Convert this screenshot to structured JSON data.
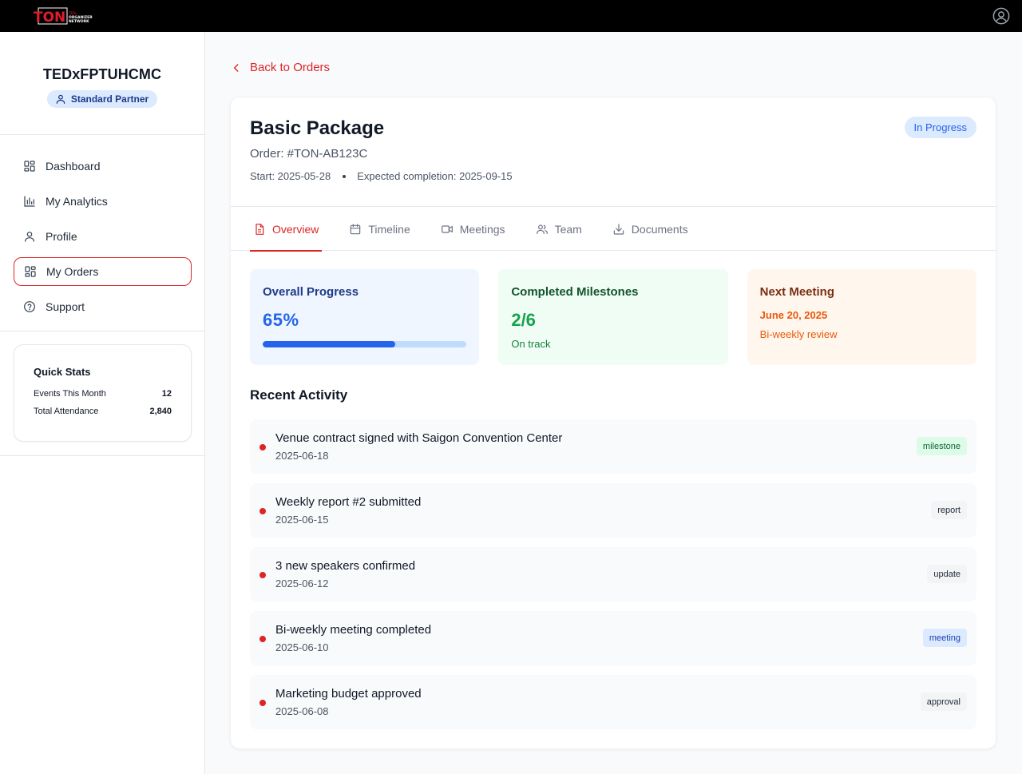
{
  "header": {
    "logo_text": "TON"
  },
  "sidebar": {
    "org_name": "TEDxFPTUHCMC",
    "partner_badge": "Standard Partner",
    "nav": [
      {
        "label": "Dashboard",
        "icon": "dashboard-icon",
        "active": false
      },
      {
        "label": "My Analytics",
        "icon": "analytics-icon",
        "active": false
      },
      {
        "label": "Profile",
        "icon": "user-icon",
        "active": false
      },
      {
        "label": "My Orders",
        "icon": "orders-icon",
        "active": true
      },
      {
        "label": "Support",
        "icon": "help-icon",
        "active": false
      }
    ],
    "quick_stats": {
      "title": "Quick Stats",
      "rows": [
        {
          "label": "Events This Month",
          "value": "12"
        },
        {
          "label": "Total Attendance",
          "value": "2,840"
        }
      ]
    }
  },
  "main": {
    "back_label": "Back to Orders",
    "package": {
      "title": "Basic Package",
      "order_id": "Order: #TON-AB123C",
      "start": "Start: 2025-05-28",
      "expected": "Expected completion: 2025-09-15",
      "status": "In Progress"
    },
    "tabs": [
      {
        "label": "Overview",
        "icon": "document-icon",
        "active": true
      },
      {
        "label": "Timeline",
        "icon": "calendar-icon",
        "active": false
      },
      {
        "label": "Meetings",
        "icon": "video-icon",
        "active": false
      },
      {
        "label": "Team",
        "icon": "team-icon",
        "active": false
      },
      {
        "label": "Documents",
        "icon": "download-icon",
        "active": false
      }
    ],
    "metrics": {
      "progress": {
        "title": "Overall Progress",
        "value": "65%",
        "fraction": 0.65
      },
      "milestones": {
        "title": "Completed Milestones",
        "value": "2/6",
        "sub": "On track"
      },
      "meeting": {
        "title": "Next Meeting",
        "date": "June 20, 2025",
        "sub": "Bi-weekly review"
      }
    },
    "recent_title": "Recent Activity",
    "activities": [
      {
        "title": "Venue contract signed with Saigon Convention Center",
        "date": "2025-06-18",
        "tag": "milestone"
      },
      {
        "title": "Weekly report #2 submitted",
        "date": "2025-06-15",
        "tag": "report"
      },
      {
        "title": "3 new speakers confirmed",
        "date": "2025-06-12",
        "tag": "update"
      },
      {
        "title": "Bi-weekly meeting completed",
        "date": "2025-06-10",
        "tag": "meeting"
      },
      {
        "title": "Marketing budget approved",
        "date": "2025-06-08",
        "tag": "approval"
      }
    ]
  },
  "colors": {
    "accent": "#dc2626",
    "progress_blue": "#2563eb",
    "success_green": "#16a34a",
    "warning_orange": "#ea580c"
  }
}
